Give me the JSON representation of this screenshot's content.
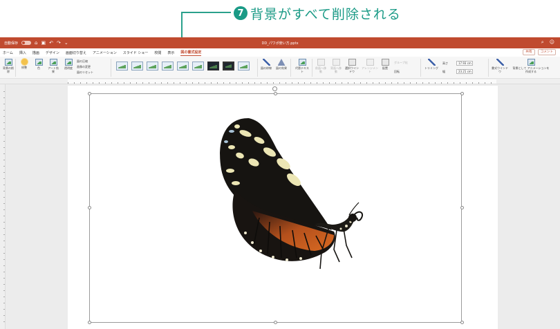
{
  "annotation": {
    "step_number": "7",
    "text": "背景がすべて削除される"
  },
  "titlebar": {
    "autosave_label": "自動保存",
    "autosave_state": "オフ",
    "file_title": "DD_パワポ使い方.pptx",
    "bar_color": "#c04a2f"
  },
  "tabs": [
    {
      "label": "ホーム"
    },
    {
      "label": "挿入"
    },
    {
      "label": "描画"
    },
    {
      "label": "デザイン"
    },
    {
      "label": "画面切り替え"
    },
    {
      "label": "アニメーション"
    },
    {
      "label": "スライド ショー"
    },
    {
      "label": "校閲"
    },
    {
      "label": "表示"
    },
    {
      "label": "図の書式設定"
    }
  ],
  "active_tab": "図の書式設定",
  "tab_actions": {
    "share": "共有",
    "comment": "コメント"
  },
  "ribbon": {
    "remove_bg": "背景の削除",
    "corrections": "修整",
    "color": "色",
    "artistic": "アート効果",
    "transparency": "透明度",
    "compress": "図の圧縮",
    "change": "画像の変更",
    "reset": "図のリセット",
    "border": "図の枠線",
    "effects": "図の効果",
    "alt_text": "代替テキスト",
    "bring_forward": "前面へ移動",
    "send_backward": "背面へ移動",
    "selection_pane": "選択ウインドウ",
    "align": "アレンジメント",
    "arrange": "配置",
    "group": "グループ化",
    "rotate": "回転",
    "crop": "トリミング",
    "height_label": "高さ",
    "height_value": "17.93 cm",
    "width_label": "幅",
    "width_value": "23.21 cm",
    "format_pane": "書式ウインドウ",
    "animate_bg": "背景として アニメーションを作成する"
  }
}
